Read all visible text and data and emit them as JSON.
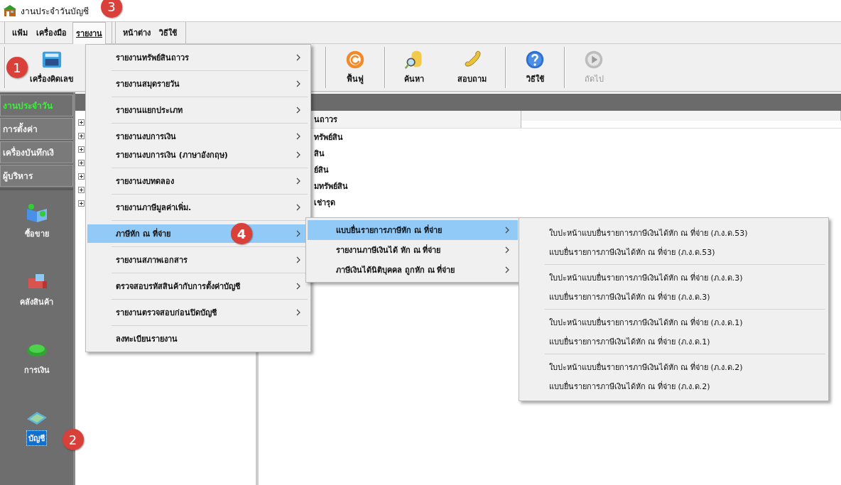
{
  "window": {
    "title": "งานประจำวันบัญชี"
  },
  "menubar": [
    [
      {
        "label": "แฟ้ม",
        "selected": false
      },
      {
        "label": "เครื่องมือ",
        "selected": false
      },
      {
        "label": "รายงาน",
        "selected": true,
        "badge": "3"
      }
    ],
    [
      {
        "label": "หน้าต่าง",
        "selected": false
      },
      {
        "label": "วิธีใช้",
        "selected": false
      }
    ]
  ],
  "toolbar": [
    [
      {
        "kind": "calculator",
        "label": "เครื่องคิดเลข",
        "disabled": false,
        "badge": "1"
      }
    ],
    [
      {
        "kind": "refresh",
        "label": "ฟื้นฟู",
        "disabled": false
      }
    ],
    [
      {
        "kind": "search",
        "label": "ค้นหา",
        "disabled": false
      },
      {
        "kind": "phone",
        "label": "สอบถาม",
        "disabled": false
      }
    ],
    [
      {
        "kind": "help",
        "label": "วิธีใช้",
        "disabled": false
      }
    ],
    [
      {
        "kind": "next",
        "label": "ถัดไป",
        "disabled": true
      }
    ]
  ],
  "sidebar": {
    "tabs": [
      {
        "label": "งานประจำวัน",
        "selected": true
      },
      {
        "label": "การตั้งค่า",
        "selected": false
      },
      {
        "label": "เครื่องบันทึกเงิ",
        "selected": false
      },
      {
        "label": "ผู้บริหาร",
        "selected": false
      }
    ],
    "modules": [
      {
        "kind": "trade",
        "label": "ซื้อขาย",
        "selected": false
      },
      {
        "kind": "warehouse",
        "label": "คลังสินค้า",
        "selected": false
      },
      {
        "kind": "money",
        "label": "การเงิน",
        "selected": false
      },
      {
        "kind": "accounts",
        "label": "บัญชี",
        "selected": true,
        "badge": "2"
      }
    ]
  },
  "tree": {
    "rows": [
      {
        "expanded": false
      },
      {
        "expanded": false
      },
      {
        "expanded": false
      },
      {
        "expanded": false
      },
      {
        "expanded": false
      },
      {
        "expanded": false
      },
      {
        "expanded": false
      }
    ]
  },
  "list": {
    "columns": [
      "นถาวร"
    ],
    "rows": [
      "ทรัพย์สิน",
      "สิน",
      "ย์สิน",
      "มทรัพย์สิน",
      "เช่ารุด"
    ]
  },
  "report_menu": [
    [
      {
        "label": "รายงานทรัพย์สินถาวร",
        "submenu": true,
        "selected": false
      }
    ],
    [
      {
        "label": "รายงานสมุดรายวัน",
        "submenu": true,
        "selected": false
      }
    ],
    [
      {
        "label": "รายงานแยกประเภท",
        "submenu": true,
        "selected": false
      }
    ],
    [
      {
        "label": "รายงานงบการเงิน",
        "submenu": true,
        "selected": false
      },
      {
        "label": "รายงานงบการเงิน (ภาษาอังกฤษ)",
        "submenu": true,
        "selected": false
      }
    ],
    [
      {
        "label": "รายงานงบทดลอง",
        "submenu": true,
        "selected": false
      }
    ],
    [
      {
        "label": "รายงานภาษีมูลค่าเพิ่ม.",
        "submenu": true,
        "selected": false
      }
    ],
    [
      {
        "label": "ภาษีหัก ณ ที่จ่าย",
        "submenu": true,
        "selected": true,
        "badge": "4"
      }
    ],
    [
      {
        "label": "รายงานสภาพเอกสาร",
        "submenu": true,
        "selected": false
      }
    ],
    [
      {
        "label": "ตรวจสอบรหัสสินค้ากับการตั้งค่าบัญชี",
        "submenu": true,
        "selected": false
      }
    ],
    [
      {
        "label": "รายงานตรวจสอบก่อนปิดบัญชี",
        "submenu": true,
        "selected": false
      }
    ],
    [
      {
        "label": "ลงทะเบียนรายงาน",
        "submenu": false,
        "selected": false
      }
    ]
  ],
  "withholding_menu": [
    [
      {
        "label": "แบบยื่นรายการภาษีหัก ณ ที่จ่าย",
        "submenu": true,
        "selected": true
      },
      {
        "label": "รายงานภาษีเงินได้ หัก ณ ที่จ่าย",
        "submenu": true,
        "selected": false
      },
      {
        "label": "ภาษีเงินได้นิติบุคคล ถูกหัก ณ ที่จ่าย",
        "submenu": true,
        "selected": false
      }
    ]
  ],
  "form_menu": [
    [
      {
        "label": "ใบปะหน้าแบบยื่นรายการภาษีเงินได้หัก ณ ที่จ่าย (ภ.ง.ด.53)",
        "submenu": false,
        "selected": false
      },
      {
        "label": "แบบยื่นรายการภาษีเงินได้หัก ณ ที่จ่าย (ภ.ง.ด.53)",
        "submenu": false,
        "selected": false
      }
    ],
    [
      {
        "label": "ใบปะหน้าแบบยื่นรายการภาษีเงินได้หัก ณ ที่จ่าย (ภ.ง.ด.3)",
        "submenu": false,
        "selected": false
      },
      {
        "label": "แบบยื่นรายการภาษีเงินได้หัก ณ ที่จ่าย (ภ.ง.ด.3)",
        "submenu": false,
        "selected": false
      }
    ],
    [
      {
        "label": "ใบปะหน้าแบบยื่นรายการภาษีเงินได้หัก ณ ที่จ่าย (ภ.ง.ด.1)",
        "submenu": false,
        "selected": false
      },
      {
        "label": "แบบยื่นรายการภาษีเงินได้หัก ณ ที่จ่าย (ภ.ง.ด.1)",
        "submenu": false,
        "selected": false
      }
    ],
    [
      {
        "label": "ใบปะหน้าแบบยื่นรายการภาษีเงินได้หัก ณ ที่จ่าย (ภ.ง.ด.2)",
        "submenu": false,
        "selected": false
      },
      {
        "label": "แบบยื่นรายการภาษีเงินได้หัก ณ ที่จ่าย (ภ.ง.ด.2)",
        "submenu": false,
        "selected": false
      }
    ]
  ]
}
